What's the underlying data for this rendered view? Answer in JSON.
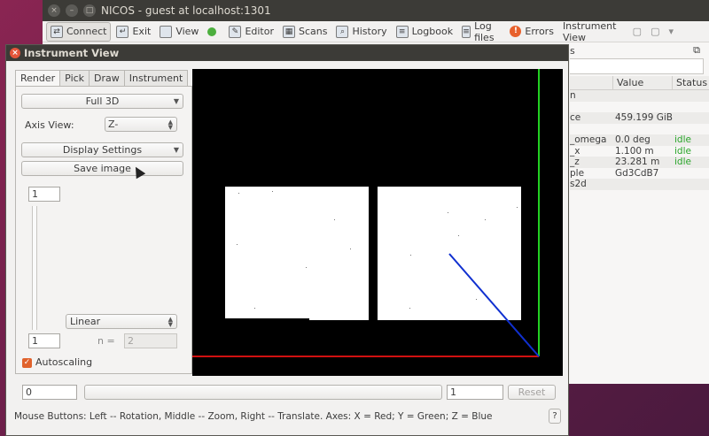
{
  "main_window": {
    "title": "NICOS - guest at localhost:1301",
    "toolbar": [
      {
        "label": "Connect",
        "icon": "connect-icon"
      },
      {
        "label": "Exit",
        "icon": "exit-icon"
      },
      {
        "label": "View",
        "icon": "view-icon"
      },
      {
        "label": "",
        "icon": "status-dot-icon"
      },
      {
        "label": "Editor",
        "icon": "editor-icon"
      },
      {
        "label": "Scans",
        "icon": "scans-icon"
      },
      {
        "label": "History",
        "icon": "history-icon"
      },
      {
        "label": "Logbook",
        "icon": "logbook-icon"
      },
      {
        "label": "Log files",
        "icon": "logfiles-icon"
      },
      {
        "label": "Errors",
        "icon": "errors-icon"
      },
      {
        "label": "Instrument View",
        "icon": ""
      }
    ],
    "device_pane": {
      "header_fragment": "s",
      "columns": [
        "",
        "Value",
        "Status"
      ],
      "rows": [
        {
          "name": "n",
          "value": "",
          "status": ""
        },
        {
          "name": "",
          "value": "",
          "status": ""
        },
        {
          "name": "ce",
          "value": "459.199 GiB",
          "status": ""
        },
        {
          "name": "",
          "value": "",
          "status": ""
        },
        {
          "name": "_omega",
          "value": "0.0 deg",
          "status": "idle"
        },
        {
          "name": "_x",
          "value": "1.100 m",
          "status": "idle"
        },
        {
          "name": "_z",
          "value": "23.281 m",
          "status": "idle"
        },
        {
          "name": "ple",
          "value": "Gd3CdB7",
          "status": ""
        },
        {
          "name": "s2d",
          "value": "",
          "status": ""
        }
      ]
    }
  },
  "instrument_view": {
    "title": "Instrument View",
    "tabs": [
      "Render",
      "Pick",
      "Draw",
      "Instrument"
    ],
    "render": {
      "projection": "Full 3D",
      "axis_view_label": "Axis View:",
      "axis_view_value": "Z-",
      "display_settings": "Display Settings",
      "save_image": "Save image",
      "colormap_max": "1",
      "colormap_min": "1",
      "scale_type": "Linear",
      "n_label": "n =",
      "n_value": "2",
      "autoscaling_label": "Autoscaling",
      "autoscaling_checked": true
    },
    "bottom": {
      "range_min": "0",
      "range_max": "1",
      "reset_label": "Reset"
    },
    "status_text": "Mouse Buttons: Left -- Rotation, Middle -- Zoom, Right -- Translate. Axes: X = Red; Y = Green; Z = Blue",
    "help_label": "?",
    "axis_colors": {
      "x": "#d01010",
      "y": "#22d022",
      "z": "#1030d0"
    }
  }
}
